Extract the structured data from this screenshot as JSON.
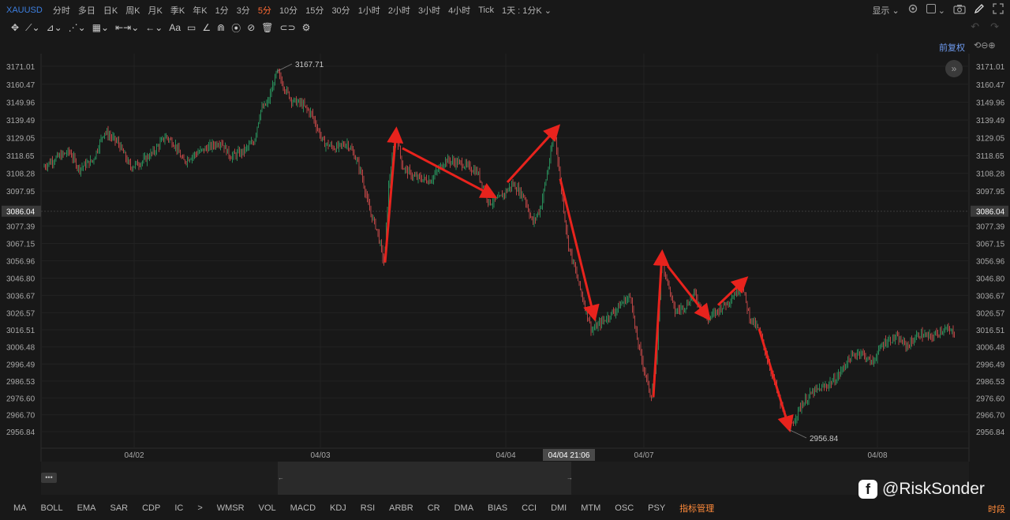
{
  "header": {
    "symbol": "XAUUSD",
    "intervals": [
      {
        "label": "分时",
        "active": false
      },
      {
        "label": "多日",
        "active": false
      },
      {
        "label": "日K",
        "active": false
      },
      {
        "label": "周K",
        "active": false
      },
      {
        "label": "月K",
        "active": false
      },
      {
        "label": "季K",
        "active": false
      },
      {
        "label": "年K",
        "active": false
      },
      {
        "label": "1分",
        "active": false
      },
      {
        "label": "3分",
        "active": false
      },
      {
        "label": "5分",
        "active": true
      },
      {
        "label": "10分",
        "active": false
      },
      {
        "label": "15分",
        "active": false
      },
      {
        "label": "30分",
        "active": false
      },
      {
        "label": "1小时",
        "active": false
      },
      {
        "label": "2小时",
        "active": false
      },
      {
        "label": "3小时",
        "active": false
      },
      {
        "label": "4小时",
        "active": false
      },
      {
        "label": "Tick",
        "active": false
      },
      {
        "label": "1天 : 1分K ⌄",
        "active": false
      }
    ],
    "display_label": "显示",
    "icons": [
      "gear-icon",
      "checkbox-icon",
      "camera-icon",
      "pen-icon",
      "fullscreen-icon"
    ]
  },
  "toolbar": {
    "tools": [
      "✥",
      "⟋⌄",
      "⊿⌄",
      "⋰⌄",
      "▦⌄",
      "⇤⇥⌄",
      "←⌄",
      "Aa",
      "▭",
      "∠",
      "⋒",
      "⦿",
      "⊘",
      "🗑",
      "⊂⊃",
      "⚙"
    ],
    "undo": "↶",
    "redo": "↷"
  },
  "adjust_label": "前复权",
  "adjust_icons": "⟲⊖⊕",
  "expand_label": "»",
  "chart_data": {
    "type": "candlestick",
    "symbol": "XAUUSD",
    "interval": "5分",
    "price_ticks": [
      3171.01,
      3160.47,
      3149.96,
      3139.49,
      3129.05,
      3118.65,
      3108.28,
      3097.95,
      3077.39,
      3067.15,
      3056.96,
      3046.8,
      3036.67,
      3026.57,
      3016.51,
      3006.48,
      2996.49,
      2986.53,
      2976.6,
      2966.7,
      2956.84
    ],
    "current_price": "3086.04",
    "date_ticks": [
      {
        "label": "04/02",
        "x": 170
      },
      {
        "label": "04/03",
        "x": 406
      },
      {
        "label": "04/04",
        "x": 641
      },
      {
        "label": "04/07",
        "x": 816
      },
      {
        "label": "04/08",
        "x": 1112
      }
    ],
    "crosshair_time": "04/04 21:06",
    "high_label": "3167.71",
    "low_label": "2956.84",
    "ylim": [
      2951,
      3175
    ],
    "price_path": [
      [
        55,
        3112
      ],
      [
        70,
        3117
      ],
      [
        88,
        3121
      ],
      [
        100,
        3111
      ],
      [
        118,
        3116
      ],
      [
        132,
        3133
      ],
      [
        150,
        3126
      ],
      [
        165,
        3112
      ],
      [
        180,
        3115
      ],
      [
        195,
        3121
      ],
      [
        210,
        3130
      ],
      [
        222,
        3125
      ],
      [
        232,
        3115
      ],
      [
        245,
        3119
      ],
      [
        262,
        3123
      ],
      [
        280,
        3127
      ],
      [
        292,
        3118
      ],
      [
        308,
        3121
      ],
      [
        322,
        3127
      ],
      [
        330,
        3145
      ],
      [
        340,
        3150
      ],
      [
        351,
        3168
      ],
      [
        360,
        3159
      ],
      [
        370,
        3151
      ],
      [
        382,
        3149
      ],
      [
        395,
        3143
      ],
      [
        410,
        3126
      ],
      [
        425,
        3123
      ],
      [
        440,
        3126
      ],
      [
        450,
        3118
      ],
      [
        458,
        3108
      ],
      [
        468,
        3087
      ],
      [
        478,
        3075
      ],
      [
        487,
        3055
      ],
      [
        492,
        3099
      ],
      [
        502,
        3133
      ],
      [
        510,
        3112
      ],
      [
        525,
        3106
      ],
      [
        545,
        3104
      ],
      [
        565,
        3116
      ],
      [
        585,
        3114
      ],
      [
        605,
        3109
      ],
      [
        620,
        3091
      ],
      [
        632,
        3093
      ],
      [
        650,
        3102
      ],
      [
        665,
        3094
      ],
      [
        675,
        3079
      ],
      [
        685,
        3088
      ],
      [
        695,
        3112
      ],
      [
        703,
        3133
      ],
      [
        710,
        3104
      ],
      [
        720,
        3067
      ],
      [
        735,
        3041
      ],
      [
        750,
        3016
      ],
      [
        765,
        3022
      ],
      [
        780,
        3028
      ],
      [
        792,
        3034
      ],
      [
        800,
        3036
      ],
      [
        805,
        3016
      ],
      [
        815,
        2996
      ],
      [
        825,
        2977
      ],
      [
        832,
        2997
      ],
      [
        838,
        3058
      ],
      [
        845,
        3047
      ],
      [
        855,
        3027
      ],
      [
        870,
        3031
      ],
      [
        880,
        3038
      ],
      [
        895,
        3022
      ],
      [
        910,
        3028
      ],
      [
        925,
        3034
      ],
      [
        940,
        3043
      ],
      [
        950,
        3024
      ],
      [
        962,
        3016
      ],
      [
        975,
        2996
      ],
      [
        990,
        2972
      ],
      [
        1000,
        2958
      ],
      [
        1015,
        2972
      ],
      [
        1030,
        2980
      ],
      [
        1045,
        2983
      ],
      [
        1060,
        2988
      ],
      [
        1075,
        2999
      ],
      [
        1090,
        3004
      ],
      [
        1105,
        2997
      ],
      [
        1120,
        3009
      ],
      [
        1135,
        3012
      ],
      [
        1150,
        3007
      ],
      [
        1165,
        3014
      ],
      [
        1180,
        3012
      ],
      [
        1195,
        3017
      ],
      [
        1210,
        3015
      ]
    ],
    "annotation_arrows": [
      {
        "from": [
          488,
          3056
        ],
        "to": [
          502,
          3133
        ]
      },
      {
        "from": [
          510,
          3123
        ],
        "to": [
          625,
          3095
        ]
      },
      {
        "from": [
          643,
          3103
        ],
        "to": [
          706,
          3135
        ]
      },
      {
        "from": [
          710,
          3105
        ],
        "to": [
          753,
          3024
        ]
      },
      {
        "from": [
          828,
          2977
        ],
        "to": [
          839,
          3061
        ]
      },
      {
        "from": [
          846,
          3054
        ],
        "to": [
          897,
          3024
        ]
      },
      {
        "from": [
          910,
          3031
        ],
        "to": [
          944,
          3046
        ]
      },
      {
        "from": [
          962,
          3017
        ],
        "to": [
          1000,
          2959
        ]
      }
    ]
  },
  "navigator": {
    "dots": "•••",
    "left_handle": "←",
    "right_handle": "→"
  },
  "indicators": [
    {
      "label": "MA",
      "highlight": false
    },
    {
      "label": "BOLL",
      "highlight": false
    },
    {
      "label": "EMA",
      "highlight": false
    },
    {
      "label": "SAR",
      "highlight": false
    },
    {
      "label": "CDP",
      "highlight": false
    },
    {
      "label": "IC",
      "highlight": false
    },
    {
      "label": ">",
      "highlight": false
    },
    {
      "label": "WMSR",
      "highlight": false
    },
    {
      "label": "VOL",
      "highlight": false
    },
    {
      "label": "MACD",
      "highlight": false
    },
    {
      "label": "KDJ",
      "highlight": false
    },
    {
      "label": "RSI",
      "highlight": false
    },
    {
      "label": "ARBR",
      "highlight": false
    },
    {
      "label": "CR",
      "highlight": false
    },
    {
      "label": "DMA",
      "highlight": false
    },
    {
      "label": "BIAS",
      "highlight": false
    },
    {
      "label": "CCI",
      "highlight": false
    },
    {
      "label": "DMI",
      "highlight": false
    },
    {
      "label": "MTM",
      "highlight": false
    },
    {
      "label": "OSC",
      "highlight": false
    },
    {
      "label": "PSY",
      "highlight": false
    },
    {
      "label": "指标管理",
      "highlight": true
    }
  ],
  "time_segment_label": "时段",
  "watermark": {
    "icon": "f",
    "text": "@RiskSonder"
  }
}
